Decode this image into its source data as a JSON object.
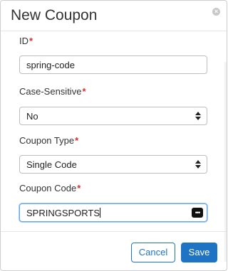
{
  "dialog": {
    "title": "New Coupon",
    "close_glyph": "×"
  },
  "form": {
    "required_mark": "*",
    "id": {
      "label": "ID",
      "value": "spring-code"
    },
    "case_sensitive": {
      "label": "Case-Sensitive",
      "value": "No",
      "icon": "updown-arrows-icon"
    },
    "coupon_type": {
      "label": "Coupon Type",
      "value": "Single Code",
      "icon": "updown-arrows-icon"
    },
    "coupon_code": {
      "label": "Coupon Code",
      "value": "SPRINGSPORTS",
      "icon": "more-dots-icon",
      "icon_glyph": "•••"
    }
  },
  "footer": {
    "cancel_label": "Cancel",
    "save_label": "Save"
  },
  "colors": {
    "accent": "#1f73c5",
    "required": "#d0312d",
    "focus_border": "#66a6ea"
  }
}
